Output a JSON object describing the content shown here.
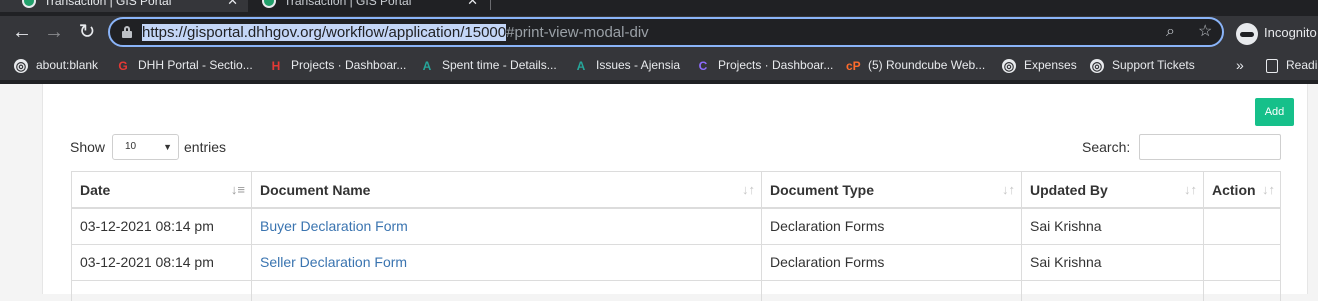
{
  "browser": {
    "tabs": [
      {
        "title": "Transaction | GIS Portal",
        "active": true
      },
      {
        "title": "Transaction | GIS Portal",
        "active": false
      }
    ],
    "address": {
      "selected": "https://gisportal.dhhgov.org/workflow/application/15000",
      "rest": "#print-view-modal-div"
    },
    "profile_label": "Incognito",
    "bookmarks": [
      {
        "label": "about:blank",
        "icon": "globe-icon"
      },
      {
        "label": "DHH Portal - Sectio...",
        "icon": "g-logo-icon"
      },
      {
        "label": "Projects · Dashboar...",
        "icon": "h-logo-icon"
      },
      {
        "label": "Spent time - Details...",
        "icon": "ajensia-icon"
      },
      {
        "label": "Issues - Ajensia",
        "icon": "ajensia-icon"
      },
      {
        "label": "Projects · Dashboar...",
        "icon": "c-logo-icon"
      },
      {
        "label": "(5) Roundcube Web...",
        "icon": "cpanel-icon"
      },
      {
        "label": "Expenses",
        "icon": "globe-icon"
      },
      {
        "label": "Support Tickets",
        "icon": "globe-icon"
      }
    ],
    "overflow_label": "»",
    "reading_list_label": "Readi"
  },
  "page": {
    "add_label": "Add",
    "show_label": "Show",
    "page_length": "10",
    "entries_label": "entries",
    "search_label": "Search:",
    "table": {
      "headers": [
        "Date",
        "Document Name",
        "Document Type",
        "Updated By",
        "Action"
      ],
      "rows": [
        {
          "date": "03-12-2021 08:14 pm",
          "document_name": "Buyer Declaration Form",
          "document_type": "Declaration Forms",
          "updated_by": "Sai Krishna",
          "action": ""
        },
        {
          "date": "03-12-2021 08:14 pm",
          "document_name": "Seller Declaration Form",
          "document_type": "Declaration Forms",
          "updated_by": "Sai Krishna",
          "action": ""
        }
      ]
    }
  },
  "colors": {
    "accent_add": "#16c08a",
    "link": "#3a74b0",
    "omnibox_focus": "#8ab4f8"
  }
}
